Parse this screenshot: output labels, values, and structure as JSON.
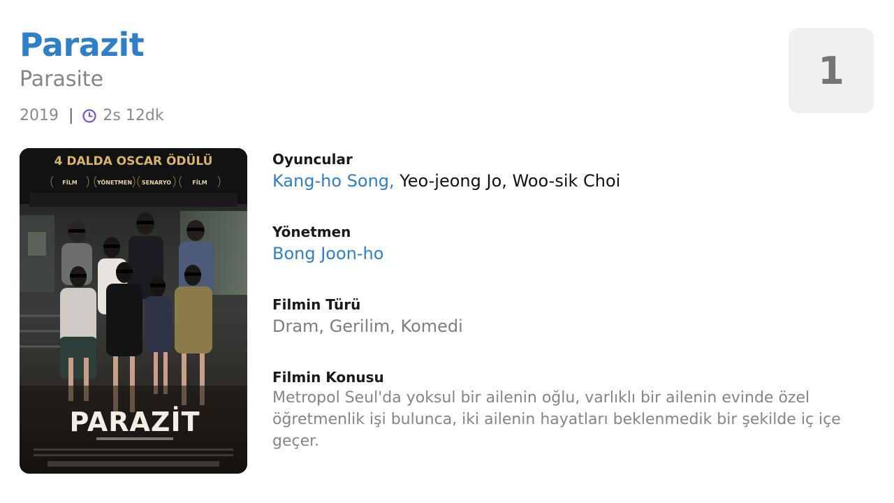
{
  "movie": {
    "title": "Parazit",
    "original_title": "Parasite",
    "year": "2019",
    "separator": "|",
    "duration": "2s 12dk",
    "rank": "1"
  },
  "poster": {
    "award_banner": "4 DALDA OSCAR ÖDÜLÜ",
    "title": "PARAZİT",
    "award_categories": [
      "FİLM",
      "YÖNETMEN",
      "SENARYO",
      "FİLM"
    ]
  },
  "details": {
    "cast_label": "Oyuncular",
    "cast": [
      "Kang-ho Song",
      "Yeo-jeong Jo",
      "Woo-sik Choi"
    ],
    "cast_separator": ", ",
    "director_label": "Yönetmen",
    "director": "Bong Joon-ho",
    "genre_label": "Filmin Türü",
    "genres": "Dram, Gerilim, Komedi",
    "plot_label": "Filmin Konusu",
    "plot": "Metropol Seul'da yoksul bir ailenin oğlu, varlıklı bir ailenin evinde özel öğretmenlik işi bulunca, iki ailenin hayatları beklenmedik bir şekilde iç içe geçer."
  },
  "colors": {
    "accent": "#2f7fc8",
    "clock_icon": "#7a4fd6",
    "rank_bg": "#f0f0f0"
  },
  "icons": {
    "duration": "clock-icon"
  }
}
